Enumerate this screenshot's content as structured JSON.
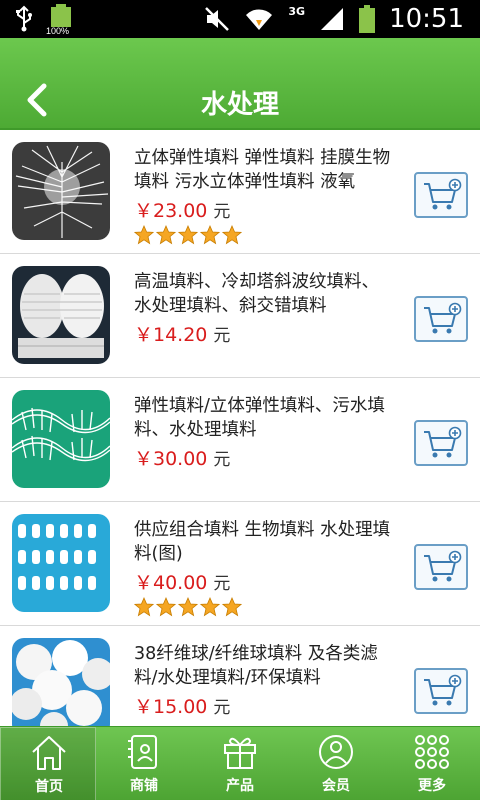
{
  "statusbar": {
    "battery_label": "100%",
    "network_label": "3G",
    "time": "10:51"
  },
  "header": {
    "title": "水处理"
  },
  "products": [
    {
      "name": "立体弹性填料 弹性填料 挂膜生物填料 污水立体弹性填料 液氧",
      "price": "￥23.00",
      "unit": "元",
      "rating": 5,
      "image": "white-fiber-brush"
    },
    {
      "name": "高温填料、冷却塔斜波纹填料、水处理填料、斜交错填料",
      "price": "￥14.20",
      "unit": "元",
      "rating": 0,
      "image": "corrugated-rolls"
    },
    {
      "name": "弹性填料/立体弹性填料、污水填料、水处理填料",
      "price": "￥30.00",
      "unit": "元",
      "rating": 0,
      "image": "elastic-filler-green"
    },
    {
      "name": "供应组合填料 生物填料 水处理填料(图)",
      "price": "￥40.00",
      "unit": "元",
      "rating": 5,
      "image": "combination-filler-blue"
    },
    {
      "name": "38纤维球/纤维球填料 及各类滤料/水处理填料/环保填料",
      "price": "￥15.00",
      "unit": "元",
      "rating": 0,
      "image": "fiber-balls"
    }
  ],
  "bottom_nav": [
    {
      "label": "首页",
      "icon": "home-icon",
      "active": true
    },
    {
      "label": "商铺",
      "icon": "shop-icon",
      "active": false
    },
    {
      "label": "产品",
      "icon": "gift-icon",
      "active": false
    },
    {
      "label": "会员",
      "icon": "member-icon",
      "active": false
    },
    {
      "label": "更多",
      "icon": "more-icon",
      "active": false
    }
  ],
  "colors": {
    "header_green": "#5bb83f",
    "price_red": "#d91d1d",
    "star_orange": "#f5a623",
    "cart_blue": "#3a7ab0"
  }
}
